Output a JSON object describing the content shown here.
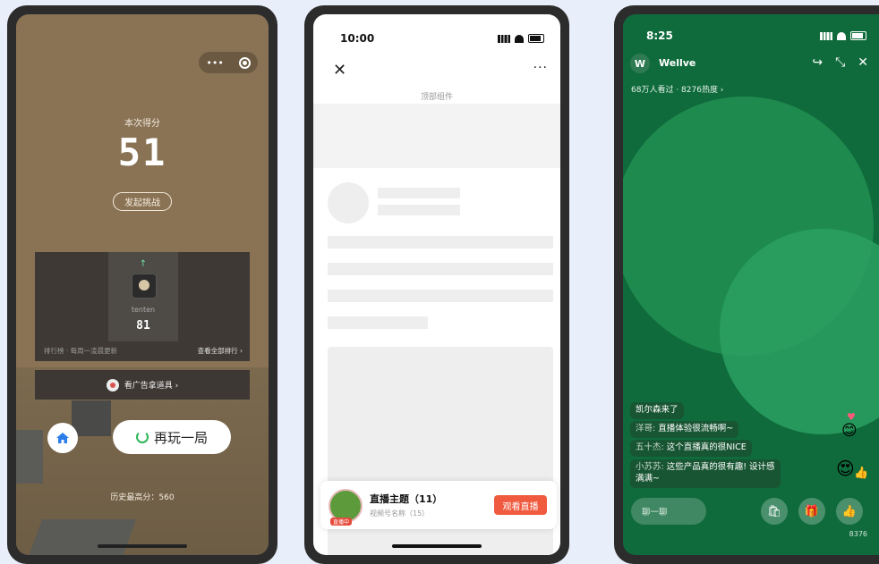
{
  "phone1": {
    "capsule": {
      "more_icon": "•••",
      "target_icon": "target-icon"
    },
    "score_label": "本次得分",
    "score": "51",
    "challenge_label": "发起挑战",
    "rank": {
      "arrow": "↑",
      "name": "tenten",
      "score": "81",
      "footer_left": "排行榜 · 每周一凌晨更新",
      "footer_right": "查看全部排行 ›"
    },
    "ad_label": "看广告拿道具 ›",
    "replay_label": "再玩一局",
    "best_score": "历史最高分：560"
  },
  "phone2": {
    "time": "10:00",
    "close_icon": "✕",
    "more_icon": "···",
    "top_label": "顶部组件",
    "live": {
      "title": "直播主题（11）",
      "sub": "视频号名称（15）",
      "badge": "直播中",
      "button": "观看直播"
    }
  },
  "phone3": {
    "time": "8:25",
    "logo_letter": "W",
    "name": "Wellve",
    "viewers": "68万人看过 · 8276热度 ›",
    "comments": [
      {
        "user": "",
        "text": "凯尔森来了"
      },
      {
        "user": "洋哥:",
        "text": " 直播体验很流畅啊~"
      },
      {
        "user": "五十杰:",
        "text": " 这个直播真的很NICE"
      },
      {
        "user": "小苏苏:",
        "text": " 这些产品真的很有趣! 设计感"
      },
      {
        "user": "",
        "text": "满满~"
      }
    ],
    "input_placeholder": "聊一聊",
    "like_count": "8376"
  },
  "colors": {
    "accent_green": "#2eb65a",
    "live_red": "#f05a3f",
    "live_bg": "#0f6b3c"
  }
}
